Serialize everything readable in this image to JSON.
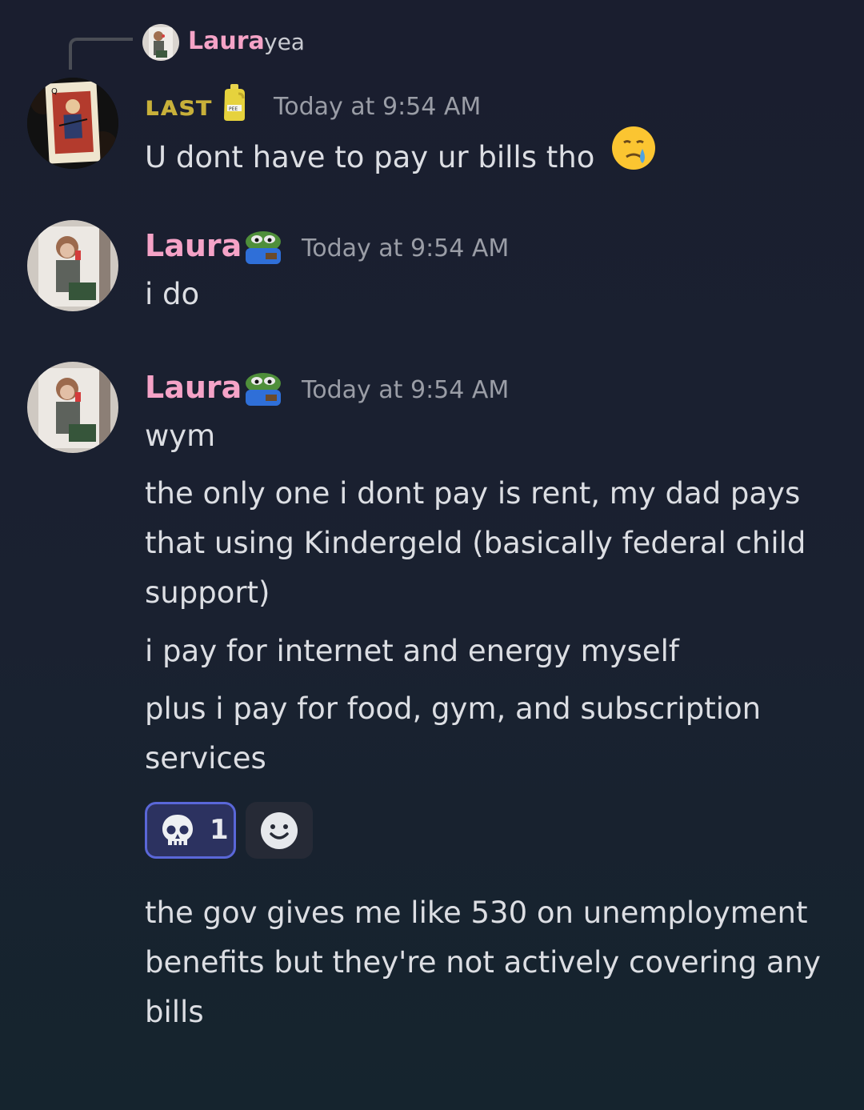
{
  "reply": {
    "author": "Laura",
    "text": "yea"
  },
  "messages": [
    {
      "author": "ʟᴀsᴛ",
      "author_color": "#c8b03a",
      "timestamp": "Today at 9:54 AM",
      "lines": [
        "U dont have to pay ur bills tho"
      ],
      "trailing_emoji": "crying-face-icon"
    },
    {
      "author": "Laura",
      "author_color": "#f5a3c7",
      "timestamp": "Today at 9:54 AM",
      "lines": [
        "i do"
      ]
    },
    {
      "author": "Laura",
      "author_color": "#f5a3c7",
      "timestamp": "Today at 9:54 AM",
      "lines": [
        "wym",
        "the only one i dont pay is rent, my dad pays that using Kindergeld (basically federal child support)",
        "i pay for internet and energy myself",
        "plus i pay for food, gym, and subscription services",
        "the gov gives me like 530 on unemployment benefits but they're not actively covering any bills"
      ]
    }
  ],
  "reactions": [
    {
      "emoji": "skull-icon",
      "count": "1",
      "active": true
    }
  ],
  "add_reaction_icon": "smiley-add-reaction-icon"
}
